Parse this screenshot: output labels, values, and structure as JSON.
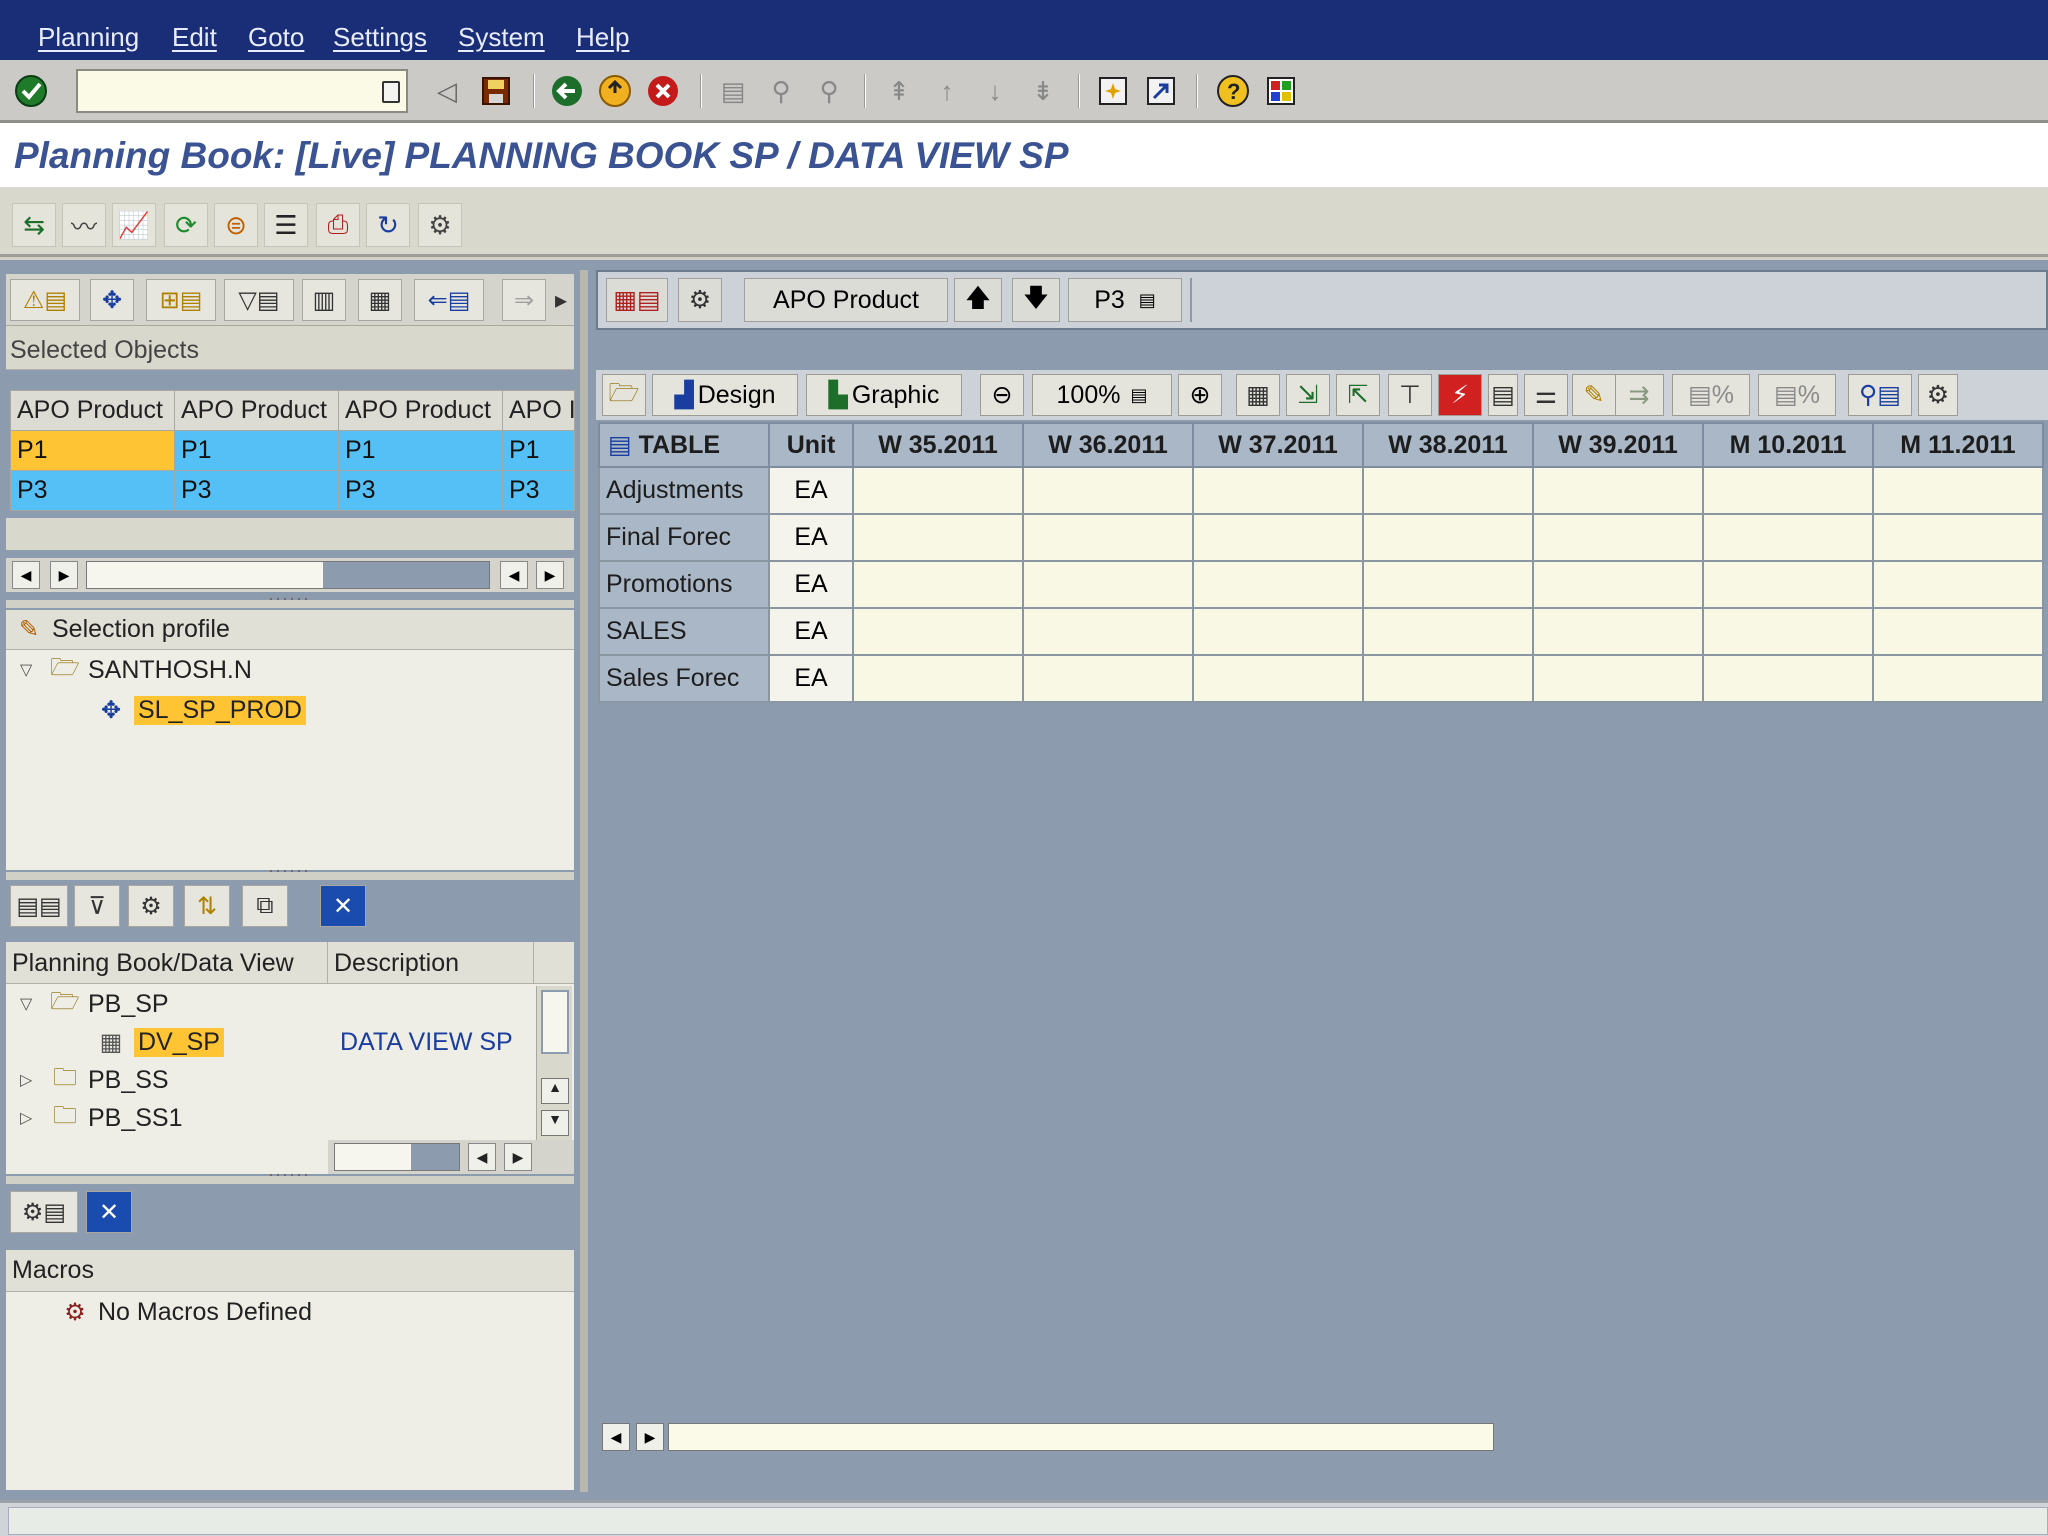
{
  "menu": [
    "Planning",
    "Edit",
    "Goto",
    "Settings",
    "System",
    "Help"
  ],
  "command_field": {
    "value": ""
  },
  "title": "Planning Book: [Live] PLANNING BOOK SP / DATA VIEW SP",
  "selected_objects": {
    "title": "Selected Objects",
    "columns": [
      "APO Product",
      "APO Product",
      "APO Product",
      "APO I"
    ],
    "rows": [
      [
        "P1",
        "P1",
        "P1",
        "P1"
      ],
      [
        "P3",
        "P3",
        "P3",
        "P3"
      ]
    ]
  },
  "selection_profile": {
    "title": "Selection profile",
    "user": "SANTHOSH.N",
    "profile": "SL_SP_PROD"
  },
  "planning_books": {
    "columns": [
      "Planning Book/Data View",
      "Description"
    ],
    "items": [
      {
        "name": "PB_SP",
        "desc": ""
      },
      {
        "name": "DV_SP",
        "desc": "DATA VIEW SP"
      },
      {
        "name": "PB_SS",
        "desc": ""
      },
      {
        "name": "PB_SS1",
        "desc": ""
      }
    ]
  },
  "macros": {
    "title": "Macros",
    "empty_text": "No Macros Defined"
  },
  "header_bar": {
    "characteristic": "APO Product",
    "value": "P3"
  },
  "grid_toolbar": {
    "design": "Design",
    "graphic": "Graphic",
    "zoom": "100%",
    "percent_a": "%",
    "percent_b": "%"
  },
  "grid": {
    "corner": "TABLE",
    "unit_header": "Unit",
    "periods": [
      "W 35.2011",
      "W 36.2011",
      "W 37.2011",
      "W 38.2011",
      "W 39.2011",
      "M 10.2011",
      "M 11.2011"
    ],
    "rows": [
      {
        "label": "Adjustments",
        "unit": "EA"
      },
      {
        "label": "Final Forec",
        "unit": "EA"
      },
      {
        "label": "Promotions",
        "unit": "EA"
      },
      {
        "label": "SALES",
        "unit": "EA"
      },
      {
        "label": "Sales Forec",
        "unit": "EA"
      }
    ]
  }
}
